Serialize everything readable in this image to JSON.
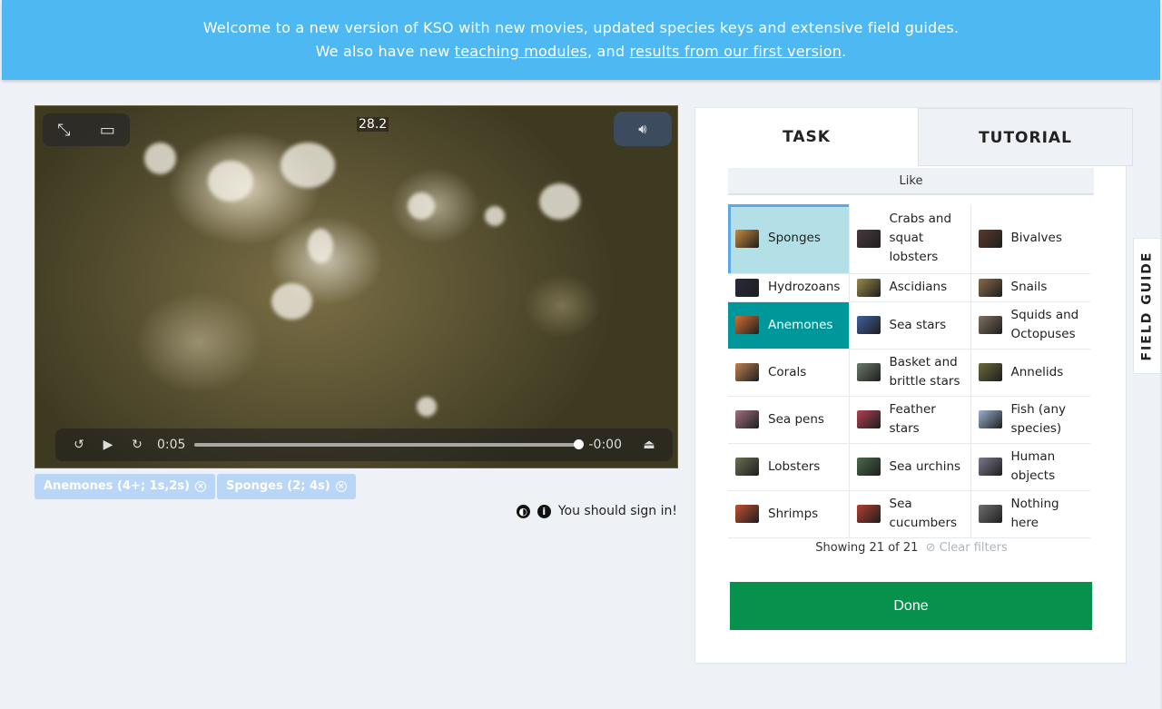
{
  "banner": {
    "line1": "Welcome to a new version of KSO with new movies, updated species keys and extensive field guides.",
    "line2_prefix": "We also have new ",
    "link1": "teaching modules",
    "line2_mid": ", and ",
    "link2": "results from our first version",
    "line2_suffix": "."
  },
  "video": {
    "overlay_time": "28.2",
    "current_time": "0:05",
    "remaining_time": "-0:00",
    "progress": 1.0
  },
  "tags": [
    {
      "label": "Anemones (4+; 1s,2s)"
    },
    {
      "label": "Sponges (2; 4s)"
    }
  ],
  "signin": {
    "text": "You should sign in!"
  },
  "tabs": {
    "task": "TASK",
    "tutorial": "TUTORIAL"
  },
  "filter": {
    "label": "Like"
  },
  "species": [
    {
      "label": "Sponges",
      "color": "#c68a3e"
    },
    {
      "label": "Crabs and squat lobsters",
      "color": "#4a3a40"
    },
    {
      "label": "Bivalves",
      "color": "#5a3a2a"
    },
    {
      "label": "Hydrozoans",
      "color": "#2a2a3a"
    },
    {
      "label": "Ascidians",
      "color": "#9a8a4a"
    },
    {
      "label": "Snails",
      "color": "#8a6a4a"
    },
    {
      "label": "Anemones",
      "color": "#d07030"
    },
    {
      "label": "Sea stars",
      "color": "#4060a0"
    },
    {
      "label": "Squids and Octopuses",
      "color": "#807060"
    },
    {
      "label": "Corals",
      "color": "#c08050"
    },
    {
      "label": "Basket and brittle stars",
      "color": "#6a7a6a"
    },
    {
      "label": "Annelids",
      "color": "#6a6a3a"
    },
    {
      "label": "Sea pens",
      "color": "#a07080"
    },
    {
      "label": "Feather stars",
      "color": "#b04050"
    },
    {
      "label": "Fish (any species)",
      "color": "#9ab0d0"
    },
    {
      "label": "Lobsters",
      "color": "#6a7050"
    },
    {
      "label": "Sea urchins",
      "color": "#4a6a4a"
    },
    {
      "label": "Human objects",
      "color": "#7a7a8a"
    },
    {
      "label": "Shrimps",
      "color": "#c05030"
    },
    {
      "label": "Sea cucumbers",
      "color": "#b04030"
    },
    {
      "label": "Nothing here",
      "color": "#707070"
    }
  ],
  "showing": {
    "text": "Showing 21 of 21",
    "clear": "Clear filters"
  },
  "done": {
    "label": "Done"
  },
  "field_guide": {
    "label": "FIELD GUIDE"
  }
}
